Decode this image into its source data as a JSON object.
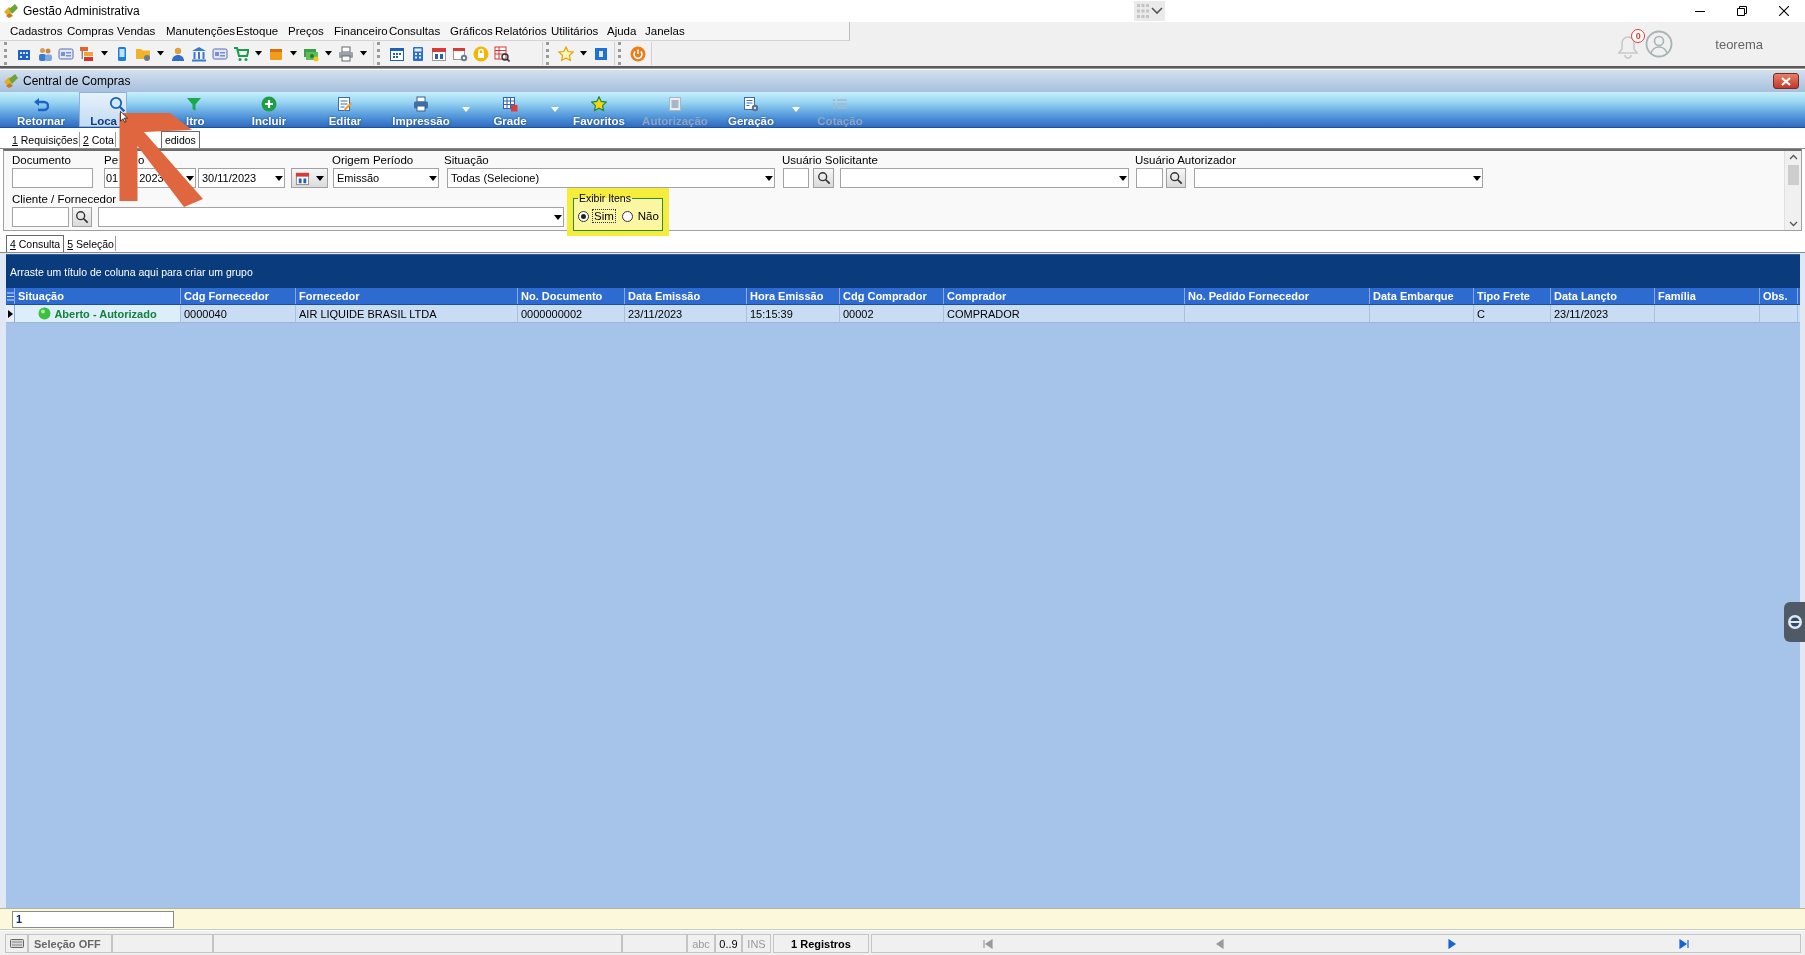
{
  "app": {
    "title": "Gestão Administrativa"
  },
  "menu": [
    {
      "label": "Cadastros"
    },
    {
      "label": "Compras"
    },
    {
      "label": "Vendas"
    },
    {
      "label": "Manutenções"
    },
    {
      "label": "Estoque"
    },
    {
      "label": "Preços"
    },
    {
      "label": "Financeiro"
    },
    {
      "label": "Consultas"
    },
    {
      "label": "Gráficos"
    },
    {
      "label": "Relatórios"
    },
    {
      "label": "Utilitários"
    },
    {
      "label": "Ajuda"
    },
    {
      "label": "Janelas"
    }
  ],
  "notifications": {
    "count": "0"
  },
  "user": {
    "name": "teorema"
  },
  "window": {
    "title": "Central de Compras"
  },
  "toolbar": [
    {
      "label": "Retornar",
      "hovered": false,
      "disabled": false,
      "dropdown": false
    },
    {
      "label": "Loca",
      "hovered": true,
      "disabled": false,
      "dropdown": false
    },
    {
      "label": "ltro",
      "hovered": false,
      "disabled": false,
      "dropdown": false
    },
    {
      "label": "Incluir",
      "hovered": false,
      "disabled": false,
      "dropdown": false
    },
    {
      "label": "Editar",
      "hovered": false,
      "disabled": false,
      "dropdown": false
    },
    {
      "label": "Impressão",
      "hovered": false,
      "disabled": false,
      "dropdown": true
    },
    {
      "label": "Grade",
      "hovered": false,
      "disabled": false,
      "dropdown": true
    },
    {
      "label": "Favoritos",
      "hovered": false,
      "disabled": false,
      "dropdown": false
    },
    {
      "label": "Autorização",
      "hovered": false,
      "disabled": true,
      "dropdown": false
    },
    {
      "label": "Geração",
      "hovered": false,
      "disabled": false,
      "dropdown": true
    },
    {
      "label": "Cotação",
      "hovered": false,
      "disabled": true,
      "dropdown": false
    }
  ],
  "tabs_top": [
    {
      "key": "1",
      "label": "Requisições",
      "selected": false
    },
    {
      "key": "2",
      "label": "Cota",
      "selected": false
    },
    {
      "label": "edidos",
      "selected": true
    }
  ],
  "filters": {
    "documento": {
      "label": "Documento"
    },
    "periodo": {
      "label_parts": [
        "Pe",
        "o"
      ],
      "from_parts": [
        "01",
        "2023"
      ],
      "to": "30/11/2023"
    },
    "origem_periodo": {
      "label": "Origem Período",
      "value": "Emissão"
    },
    "situacao": {
      "label": "Situação",
      "value": "Todas (Selecione)"
    },
    "usuario_solicitante": {
      "label": "Usuário Solicitante"
    },
    "usuario_autorizador": {
      "label": "Usuário Autorizador"
    },
    "cliente_fornecedor": {
      "label": "Cliente / Fornecedor"
    },
    "exibir_itens": {
      "label": "Exibir Itens",
      "highlighted": true,
      "options": [
        {
          "label": "Sim",
          "selected": true
        },
        {
          "label": "Não",
          "selected": false
        }
      ]
    }
  },
  "tabs_bottom": [
    {
      "key": "4",
      "label": "Consulta",
      "selected": true
    },
    {
      "key": "5",
      "label": "Seleção",
      "selected": false
    }
  ],
  "grid": {
    "group_hint": "Arraste um título de coluna aqui para criar um grupo",
    "columns": [
      "Situação",
      "Cdg Fornecedor",
      "Fornecedor",
      "No. Documento",
      "Data Emissão",
      "Hora Emissão",
      "Cdg Comprador",
      "Comprador",
      "No. Pedido Fornecedor",
      "Data Embarque",
      "Tipo Frete",
      "Data Lançto",
      "Família",
      "Obs."
    ],
    "rows": [
      {
        "current": true,
        "cells": [
          "Aberto - Autorizado",
          "0000040",
          "AIR LIQUIDE BRASIL LTDA",
          "0000000002",
          "23/11/2023",
          "15:15:39",
          "00002",
          "COMPRADOR",
          null,
          null,
          "C",
          "23/11/2023",
          null,
          null
        ]
      }
    ]
  },
  "footer": {
    "value": "1"
  },
  "status_bar": {
    "selection": "Seleção OFF",
    "modes": [
      {
        "label": "abc",
        "active": false
      },
      {
        "label": "0..9",
        "active": true
      },
      {
        "label": "INS",
        "active": false
      }
    ],
    "records": "1 Registros",
    "navigation": [
      {
        "kind": "first",
        "disabled": true
      },
      {
        "kind": "prev",
        "disabled": true
      },
      {
        "kind": "next",
        "disabled": false
      },
      {
        "kind": "last",
        "disabled": false
      }
    ]
  }
}
